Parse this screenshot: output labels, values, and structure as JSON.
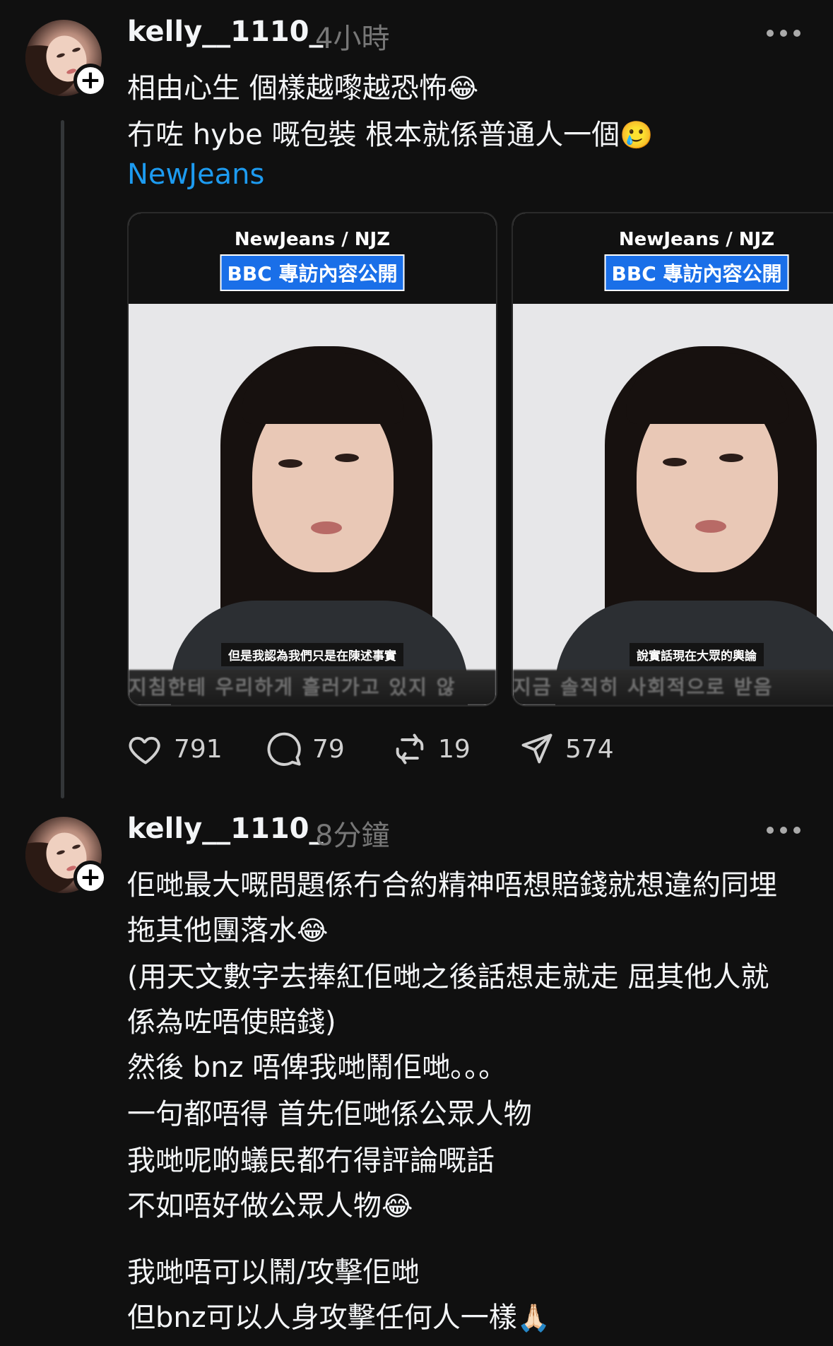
{
  "posts": [
    {
      "username": "kelly__1110_",
      "time": "4小時",
      "lines": [
        {
          "text": "相由心生 個樣越嚟越恐怖",
          "emoji": "😂"
        },
        {
          "text": "冇咗 hybe 嘅包裝 根本就係普通人一個",
          "emoji": "🥲"
        }
      ],
      "tag": "NewJeans",
      "media": [
        {
          "brand": "NewJeans / NJZ",
          "label": "BBC 專訪內容公開",
          "subtitle": "但是我認為我們只是在陳述事實",
          "blurred_caption": "지침한테 우리하게 흘러가고 있지 않"
        },
        {
          "brand": "NewJeans / NJZ",
          "label": "BBC 專訪內容公開",
          "subtitle": "說實話現在大眾的輿論",
          "blurred_caption": "지금 솔직히 사회적으로 받음"
        }
      ],
      "actions": {
        "likes": "791",
        "replies": "79",
        "reposts": "19",
        "shares": "574"
      }
    },
    {
      "username": "kelly__1110_",
      "time": "8分鐘",
      "lines": [
        {
          "text": "佢哋最大嘅問題係冇合約精神唔想賠錢就想違約同埋",
          "emoji": ""
        },
        {
          "text": "拖其他團落水",
          "emoji": "😂"
        },
        {
          "text": "(用天文數字去捧紅佢哋之後話想走就走 屈其他人就",
          "emoji": ""
        },
        {
          "text": "係為咗唔使賠錢)",
          "emoji": ""
        },
        {
          "text": "然後 bnz 唔俾我哋鬧佢哋。。。",
          "emoji": ""
        },
        {
          "text": "一句都唔得 首先佢哋係公眾人物",
          "emoji": ""
        },
        {
          "text": "我哋呢啲蟻民都冇得評論嘅話",
          "emoji": ""
        },
        {
          "text": "不如唔好做公眾人物",
          "emoji": "😂"
        },
        {
          "text": "我哋唔可以鬧/攻擊佢哋",
          "emoji": ""
        },
        {
          "text": "但bnz可以人身攻擊任何人一樣",
          "emoji": "🙏🏻"
        }
      ]
    }
  ],
  "icons": {
    "like": "heart-icon",
    "reply": "comment-icon",
    "repost": "repost-icon",
    "share": "send-icon",
    "more": "more-icon"
  },
  "colors": {
    "background": "#101010",
    "text": "#f3f5f7",
    "muted": "#777777",
    "link": "#1d9bf0"
  }
}
